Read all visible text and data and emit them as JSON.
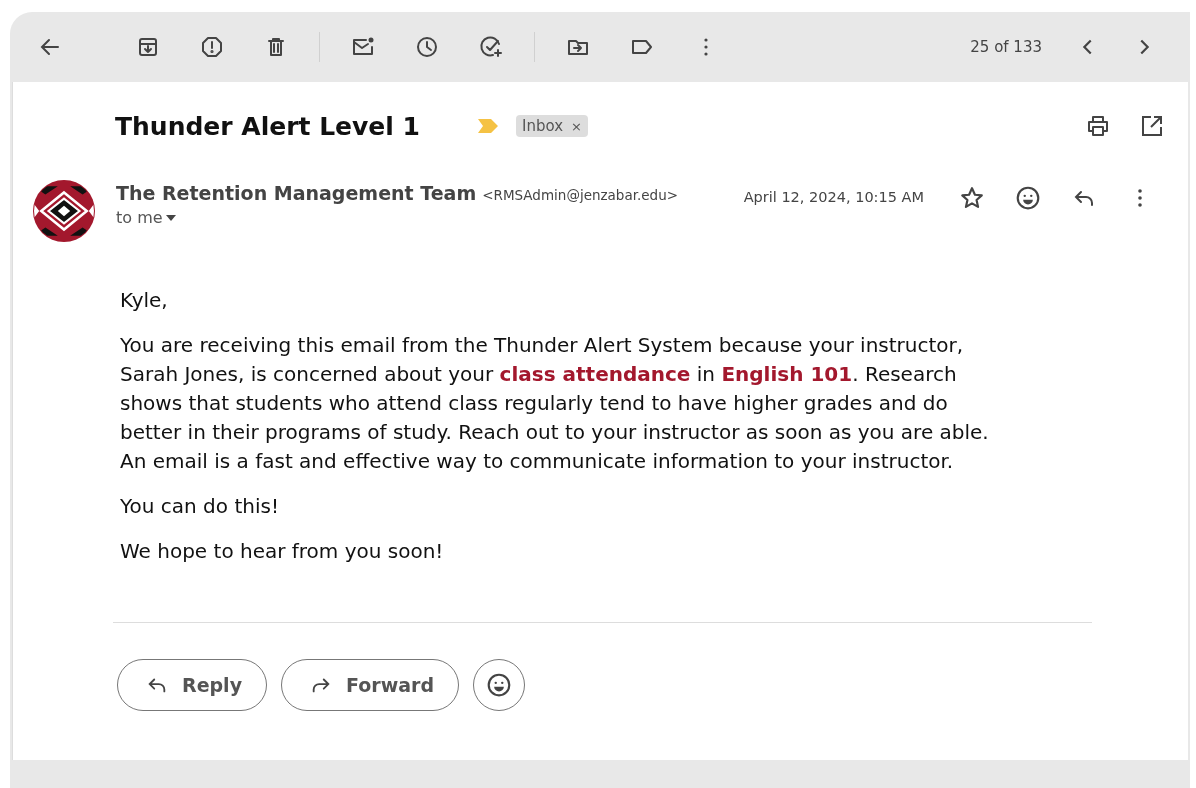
{
  "toolbar": {
    "counter": "25 of 133"
  },
  "message": {
    "subject": "Thunder Alert Level 1",
    "important": true,
    "labels": [
      {
        "name": "Inbox",
        "remove": "×"
      }
    ],
    "sender": {
      "name": "The Retention Management Team",
      "email": "<RMSAdmin@jenzabar.edu>"
    },
    "recipient": "to me",
    "date": "April 12, 2024, 10:15 AM",
    "starred": false,
    "body": [
      "Kyle,",
      "You are receiving this email from the Thunder Alert System because your instructor, Sarah Jones, is concerned about your **class attendance** in **English 101**. Research shows that students who attend class regularly tend to have higher grades and do better in their programs of study. Reach out to your instructor as soon as you are able. An email is a fast and effective way to communicate information to your instructor.",
      "You can do this!",
      "We hope to hear from you soon!"
    ]
  },
  "actions": [
    {
      "kind": "reply",
      "label": "Reply"
    },
    {
      "kind": "forward",
      "label": "Forward"
    }
  ]
}
